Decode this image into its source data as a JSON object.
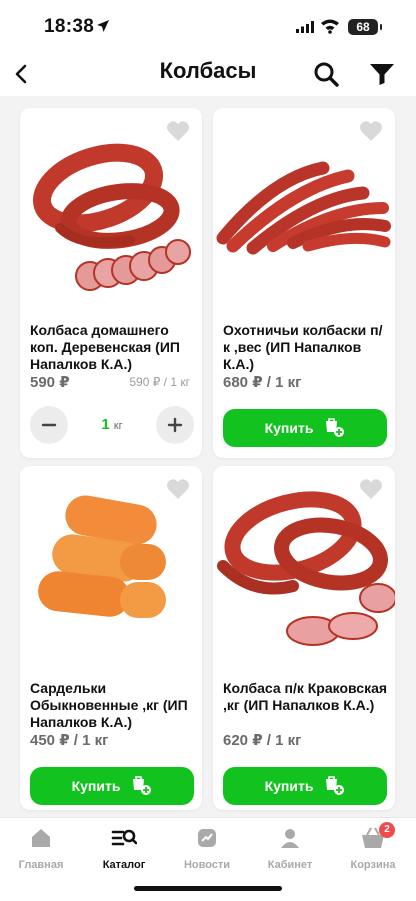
{
  "status_bar": {
    "time": "18:38",
    "battery": "68"
  },
  "header": {
    "title": "Колбасы"
  },
  "products": [
    {
      "name": "Колбаса домашнего коп.  Деревенская (ИП Напалков К.А.)",
      "price": "590 ₽",
      "unit_price": "590 ₽ / 1 кг",
      "quantity": "1",
      "quantity_unit": "кг",
      "image_icon": "sausage-ring-icon"
    },
    {
      "name": "Охотничьи колбаски п/к ,вес (ИП Напалков К.А.)",
      "price": "680 ₽ / 1 кг",
      "buy_label": "Купить",
      "image_icon": "hunting-sausages-icon"
    },
    {
      "name": "Сардельки Обыкновенные  ,кг (ИП Напалков К.А.)",
      "price": "450 ₽ / 1 кг",
      "buy_label": "Купить",
      "image_icon": "sardelki-icon"
    },
    {
      "name": "Колбаса п/к Краковская ,кг (ИП Напалков К.А.)",
      "price": "620 ₽ / 1 кг",
      "buy_label": "Купить",
      "image_icon": "krakow-sausage-icon"
    }
  ],
  "nav": {
    "items": [
      {
        "label": "Главная",
        "icon": "home-icon"
      },
      {
        "label": "Каталог",
        "icon": "catalog-search-icon"
      },
      {
        "label": "Новости",
        "icon": "news-icon"
      },
      {
        "label": "Кабинет",
        "icon": "user-icon"
      },
      {
        "label": "Корзина",
        "icon": "basket-icon",
        "badge": "2"
      }
    ],
    "active": "Каталог"
  },
  "colors": {
    "accent": "#12c21e",
    "badge": "#f04a4a",
    "sausage": "#c0392b"
  }
}
